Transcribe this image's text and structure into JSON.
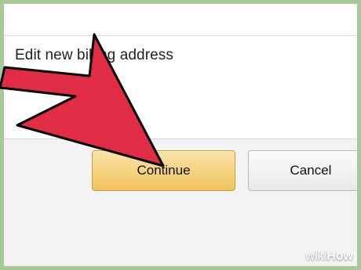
{
  "section": {
    "label": "Edit new billing address"
  },
  "buttons": {
    "continue": "Continue",
    "cancel": "Cancel"
  },
  "overlay": {
    "arrow_color": "#e02d45",
    "arrow_icon": "pointer-arrow-icon"
  },
  "watermark": {
    "prefix": "wiki",
    "suffix": "How"
  },
  "colors": {
    "continue_button": "#f2c45e",
    "cancel_button": "#eeeeee",
    "frame_border": "#a8c89a"
  }
}
